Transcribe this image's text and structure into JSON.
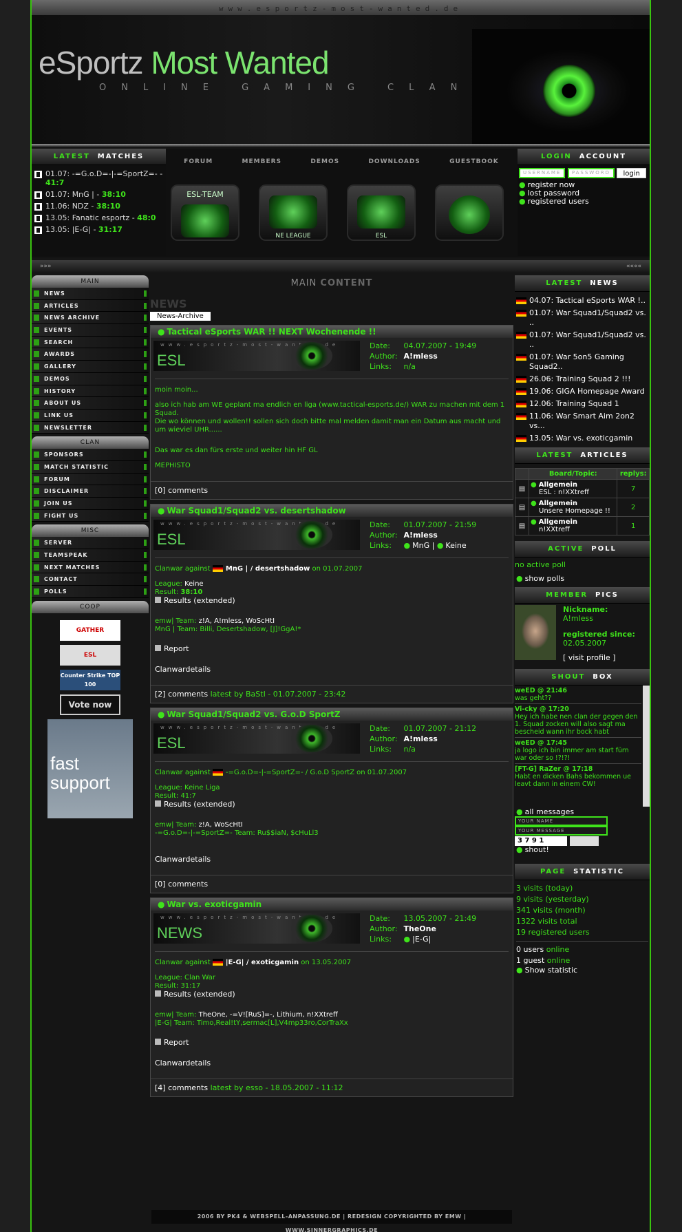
{
  "site": {
    "url_strip": "www.esportz-most-wanted.de",
    "logo_part1": "eSportz ",
    "logo_part2": "Most Wanted",
    "tagline": "ONLINE GAMING CLAN"
  },
  "latest_matches": {
    "title_a": "LATEST",
    "title_b": "MATCHES",
    "rows": [
      {
        "text": "01.07: -=G.o.D=-|-=SportZ=- - ",
        "score": "41:7"
      },
      {
        "text": "01.07: MnG | - ",
        "score": "38:10"
      },
      {
        "text": "11.06: NDZ - ",
        "score": "38:10"
      },
      {
        "text": "13.05: Fanatic esportz - ",
        "score": "48:0"
      },
      {
        "text": "13.05: |E-G| - ",
        "score": "31:17"
      }
    ]
  },
  "topnav": [
    "FORUM",
    "MEMBERS",
    "DEMOS",
    "DOWNLOADS",
    "GUESTBOOK"
  ],
  "bigbuttons": [
    "ESL-TEAM",
    "NE LEAGUE",
    "ESL",
    ""
  ],
  "login": {
    "title_a": "LOGIN",
    "title_b": "ACCOUNT",
    "username_placeholder": "USERNAME",
    "password_placeholder": "PASSWORD",
    "login_button": "login",
    "links": [
      "register now",
      "lost password",
      "registered users"
    ]
  },
  "sepbar": {
    "left": "»»»",
    "right": "««««"
  },
  "left_menu": {
    "main_head": "MAIN",
    "main_items": [
      "NEWS",
      "ARTICLES",
      "NEWS ARCHIVE",
      "EVENTS",
      "SEARCH",
      "AWARDS",
      "GALLERY",
      "DEMOS",
      "HISTORY",
      "ABOUT US",
      "LINK US",
      "NEWSLETTER"
    ],
    "clan_head": "CLAN",
    "clan_items": [
      "SPONSORS",
      "MATCH STATISTIC",
      "FORUM",
      "DISCLAIMER",
      "JOIN US",
      "FIGHT US"
    ],
    "misc_head": "MISC",
    "misc_items": [
      "SERVER",
      "TEAMSPEAK",
      "NEXT MATCHES",
      "CONTACT",
      "POLLS"
    ],
    "coop_head": "COOP",
    "coop_items": [
      "GATHER",
      "ESL",
      "Counter Strike TOP 100",
      "Vote now"
    ],
    "fast_support": "fast support"
  },
  "center": {
    "title_a": "MAIN",
    "title_b": "CONTENT",
    "news_heading": "NEWS",
    "archive_button": "News-Archive",
    "labels": {
      "date": "Date:",
      "author": "Author:",
      "links": "Links:"
    }
  },
  "posts": [
    {
      "title": "Tactical eSports WAR !! NEXT Wochenende !!",
      "banner": "ESL",
      "date": "04.07.2007 - 19:49",
      "author": "A!mless",
      "links": "n/a",
      "body": [
        "moin moin...",
        "also ich hab am WE geplant ma endlich en liga (www.tactical-esports.de/) WAR zu machen mit dem 1 Squad.",
        "Die wo können und wollen!! sollen sich doch bitte mal melden damit man ein Datum aus macht und um wieviel UHR......",
        "Das war es dan fürs erste und weiter hin HF GL",
        "MEPHISTO"
      ],
      "comments": "[0] comments"
    },
    {
      "title": "War Squad1/Squad2 vs. desertshadow",
      "banner": "ESL",
      "date": "01.07.2007 - 21:59",
      "author": "A!mless",
      "links_a": "MnG |",
      "links_b": "Keine",
      "clanwar_pre": "Clanwar against ",
      "opponent": "MnG | / desertshadow",
      "on": " on 01.07.2007",
      "league_label": "League:",
      "league": "Keine",
      "result_label": "Result:",
      "result": "38:10",
      "results_ext": "Results (extended)",
      "team1_label": "emw| Team:",
      "team1": "z!A, A!mless, WoScHtI",
      "team2": "MnG | Team: Billi, Desertshadow, [J]!GgA!*",
      "report": "Report",
      "details": "Clanwardetails",
      "comments": "[2] comments",
      "latest": "latest by BaStI - 01.07.2007 - 23:42"
    },
    {
      "title": "War Squad1/Squad2 vs. G.o.D SportZ",
      "banner": "ESL",
      "date": "01.07.2007 - 21:12",
      "author": "A!mless",
      "links": "n/a",
      "clanwar_pre": "Clanwar against ",
      "opponent": "-=G.o.D=-|-=SportZ=- / G.o.D SportZ",
      "on": " on 01.07.2007",
      "league_line": "League: Keine Liga",
      "result_line": "Result: 41:7",
      "results_ext": "Results (extended)",
      "team1_label": "emw| Team:",
      "team1": "z!A, WoScHtI",
      "team2": "-=G.o.D=-|-=SportZ=- Team: Ru$$iaN, $cHuLl3",
      "details": "Clanwardetails",
      "comments": "[0] comments"
    },
    {
      "title": "War vs. exoticgamin",
      "banner": "NEWS",
      "date": "13.05.2007 - 21:49",
      "author": "TheOne",
      "links": "|E-G|",
      "clanwar_pre": "Clanwar against ",
      "opponent": "|E-G| / exoticgamin",
      "on": " on 13.05.2007",
      "league_line": "League: Clan War",
      "result_line": "Result: 31:17",
      "results_ext": "Results (extended)",
      "team1_label": "emw| Team:",
      "team1": "TheOne, -=V![RuS]=-, Lithium, n!XXtreff",
      "team2": "|E-G| Team: Timo,Real!tY,sermac[L],V4mp33ro,CorTraXx",
      "report": "Report",
      "details": "Clanwardetails",
      "comments": "[4] comments",
      "latest": "latest by esso - 18.05.2007 - 11:12"
    }
  ],
  "right": {
    "news_title_a": "LATEST",
    "news_title_b": "NEWS",
    "news": [
      "04.07: Tactical eSports WAR !..",
      "01.07: War Squad1/Squad2 vs. ..",
      "01.07: War Squad1/Squad2 vs. ..",
      "01.07: War 5on5 Gaming Squad2..",
      "26.06: Training Squad 2 !!!",
      "19.06: GIGA Homepage Award",
      "12.06: Training Squad 1",
      "11.06: War Smart Aim 2on2 vs...",
      "13.05: War vs. exoticgamin"
    ],
    "articles_title_a": "LATEST",
    "articles_title_b": "ARTICLES",
    "articles_header": [
      "Board/Topic:",
      "replys:"
    ],
    "articles": [
      {
        "board": "Allgemein",
        "topic": "ESL : n!XXtreff",
        "replies": "7"
      },
      {
        "board": "Allgemein",
        "topic": "Unsere Homepage !!",
        "replies": "2"
      },
      {
        "board": "Allgemein",
        "topic": "n!XXtreff",
        "replies": "1"
      }
    ],
    "poll_title_a": "ACTIVE",
    "poll_title_b": "POLL",
    "poll_text": "no active poll",
    "poll_link": "show polls",
    "pics_title_a": "MEMBER",
    "pics_title_b": "PICS",
    "nick_label": "Nickname:",
    "nick": "A!mless",
    "since_label": "registered since:",
    "since": "02.05.2007",
    "visit": "[ visit profile ]",
    "shout_title_a": "SHOUT",
    "shout_title_b": "BOX",
    "shouts": [
      {
        "who": "weED @ 21:46",
        "msg": "was geht??"
      },
      {
        "who": "Vi-cky @ 17:20",
        "msg": "Hey ich habe nen clan der gegen den 1. Squad zocken will also sagt ma bescheid wann ihr bock habt"
      },
      {
        "who": "weED @ 17:45",
        "msg": "ja logo ich bin immer am start fürn war oder so !?!?!"
      },
      {
        "who": "[FT-G] RaZer @ 17:18",
        "msg": "Habt en dicken Bahs bekommen ue leavt dann in einem CW!"
      }
    ],
    "all_messages": "all messages",
    "your_name": "YOUR NAME",
    "your_message": "YOUR MESSAGE",
    "captcha": "3 7 9 1",
    "shout_btn": "shout!",
    "stat_title_a": "PAGE",
    "stat_title_b": "STATISTIC",
    "stats": [
      "3 visits (today)",
      "9 visits (yesterday)",
      "341 visits (month)",
      "1322 visits total",
      "19 registered users"
    ],
    "users_online": "0 users",
    "guest_online": "1 guest",
    "online_word": "online",
    "show_stat": "Show statistic"
  },
  "footer": "2006 BY PK4 & WEBSPELL-ANPASSUNG.DE  |  REDESIGN COPYRIGHTED BY EMW  |  WWW.SINNERGRAPHICS.DE",
  "colors": {
    "accent": "#3fe31b",
    "background": "#151515"
  }
}
